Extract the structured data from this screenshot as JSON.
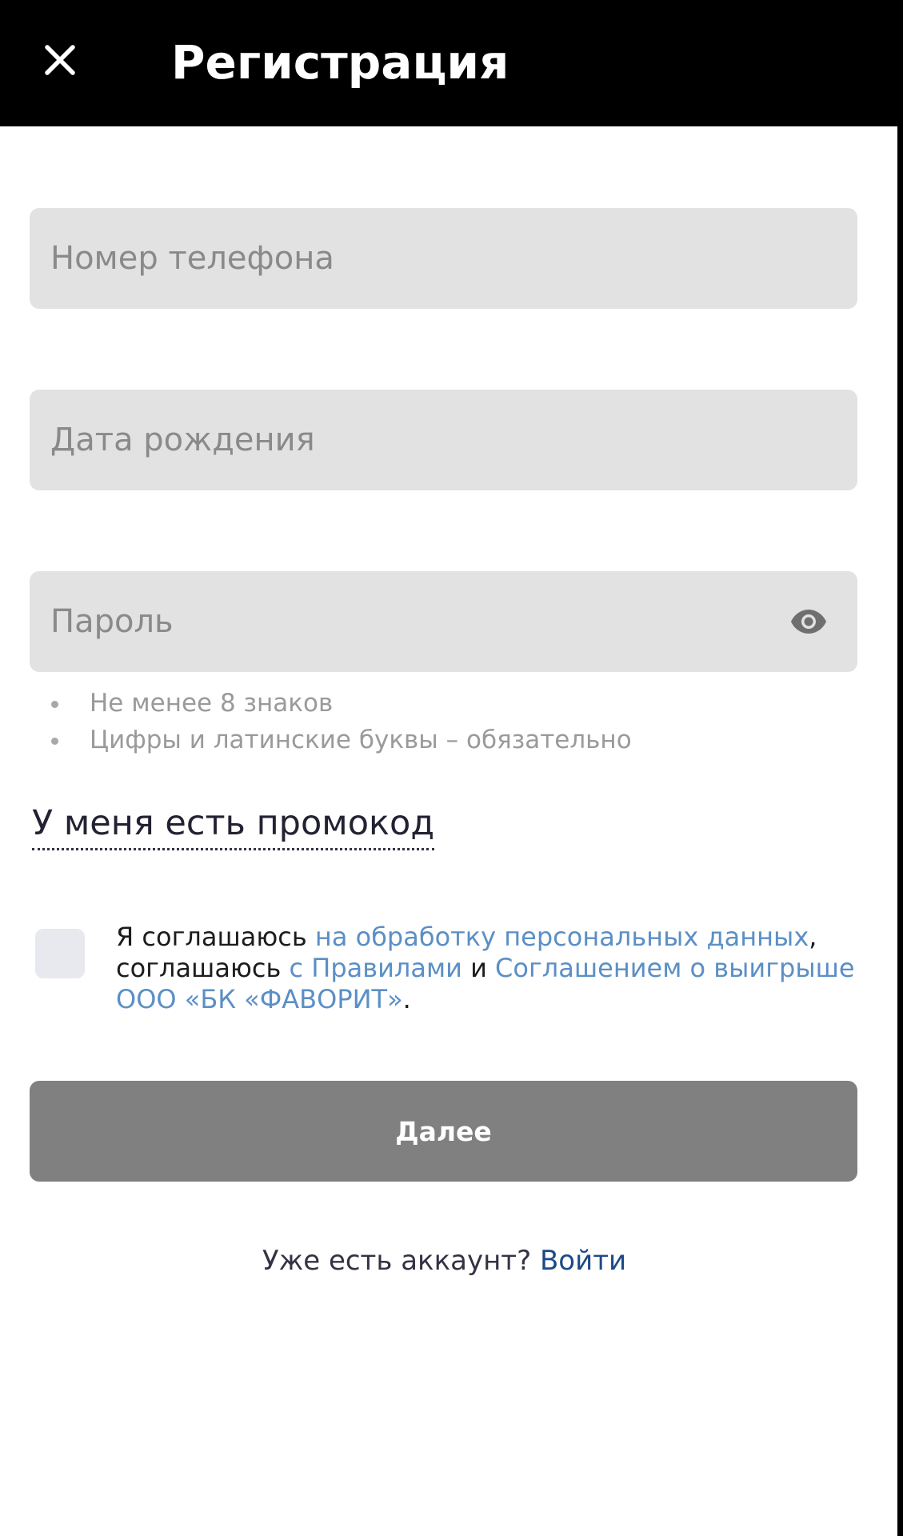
{
  "header": {
    "title": "Регистрация",
    "close_icon": "close-icon"
  },
  "form": {
    "phone_placeholder": "Номер телефона",
    "phone_value": "",
    "birthdate_placeholder": "Дата рождения",
    "birthdate_value": "",
    "password_placeholder": "Пароль",
    "password_value": "",
    "password_toggle_icon": "eye-icon",
    "password_hints": [
      "Не менее 8 знаков",
      "Цифры и латинские буквы – обязательно"
    ],
    "promo_label": "У меня есть промокод"
  },
  "consent": {
    "checked": false,
    "part1": "Я соглашаюсь ",
    "link_personal_data": "на обработку персональных данных",
    "part2": ", соглашаюсь ",
    "link_rules": "с Правилами",
    "part3": " и ",
    "link_agreement": "Соглашением о выигрыше ООО «БК «ФАВОРИТ»",
    "part4": "."
  },
  "actions": {
    "next_label": "Далее",
    "have_account_text": "Уже есть аккаунт? ",
    "login_link": "Войти"
  },
  "colors": {
    "header_bg": "#000000",
    "field_bg": "#e2e2e2",
    "link": "#5b8fc5",
    "login_link": "#1d4a86",
    "button_bg": "#808080"
  }
}
